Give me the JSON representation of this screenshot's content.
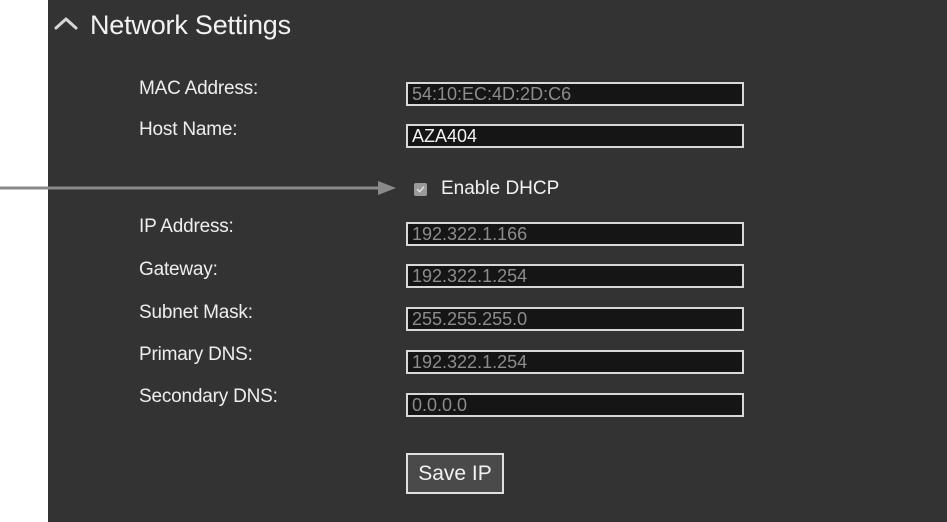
{
  "section": {
    "title": "Network Settings",
    "collapse_icon": "chevron-up-icon"
  },
  "fields": {
    "mac_label": "MAC Address:",
    "mac_value": "54:10:EC:4D:2D:C6",
    "host_label": "Host Name:",
    "host_value": "AZA404",
    "ip_label": "IP Address:",
    "ip_value": "192.322.1.166",
    "gateway_label": "Gateway:",
    "gateway_value": "192.322.1.254",
    "subnet_label": "Subnet Mask:",
    "subnet_value": "255.255.255.0",
    "primary_dns_label": "Primary DNS:",
    "primary_dns_value": "192.322.1.254",
    "secondary_dns_label": "Secondary DNS:",
    "secondary_dns_value": "0.0.0.0"
  },
  "dhcp": {
    "label": "Enable DHCP",
    "checked": true
  },
  "actions": {
    "save_label": "Save IP"
  },
  "colors": {
    "panel_background": "#333333",
    "field_background": "#151515",
    "pointer_line": "#8a8a8a"
  }
}
